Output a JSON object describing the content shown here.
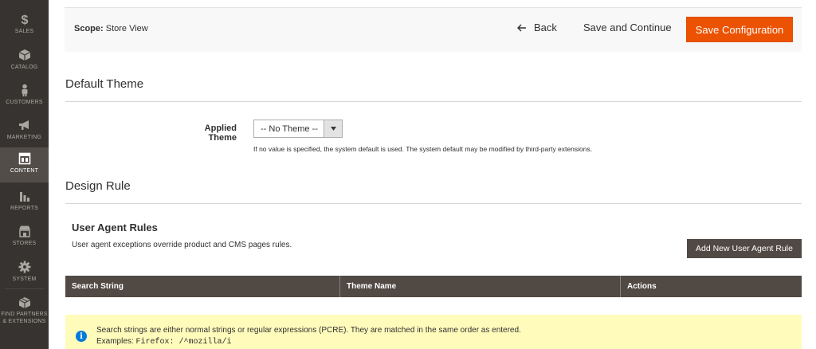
{
  "sidebar": {
    "items": [
      {
        "label": "SALES",
        "icon": "dollar-icon"
      },
      {
        "label": "CATALOG",
        "icon": "cube-icon"
      },
      {
        "label": "CUSTOMERS",
        "icon": "person-icon"
      },
      {
        "label": "MARKETING",
        "icon": "megaphone-icon"
      },
      {
        "label": "CONTENT",
        "icon": "layout-icon"
      },
      {
        "label": "REPORTS",
        "icon": "bar-chart-icon"
      },
      {
        "label": "STORES",
        "icon": "storefront-icon"
      },
      {
        "label": "SYSTEM",
        "icon": "gear-icon"
      },
      {
        "label_line1": "FIND PARTNERS",
        "label_line2": "& EXTENSIONS",
        "icon": "partner-cube-icon"
      }
    ],
    "active": "CONTENT"
  },
  "topbar": {
    "scope_label": "Scope:",
    "scope_value": "Store View",
    "back_label": "Back",
    "save_continue_label": "Save and Continue",
    "save_config_label": "Save Configuration"
  },
  "default_theme": {
    "title": "Default Theme",
    "applied_theme_label": "Applied Theme",
    "applied_theme_value": "-- No Theme --",
    "note": "If no value is specified, the system default is used. The system default may be modified by third-party extensions."
  },
  "design_rule": {
    "title": "Design Rule",
    "user_agent_title": "User Agent Rules",
    "user_agent_desc": "User agent exceptions override product and CMS pages rules.",
    "add_button_label": "Add New User Agent Rule",
    "columns": [
      "Search String",
      "Theme Name",
      "Actions"
    ],
    "notice_line1": "Search strings are either normal strings or regular expressions (PCRE). They are matched in the same order as entered.",
    "notice_examples_label": "Examples:",
    "notice_examples_code": "Firefox: /^mozilla/i"
  },
  "colors": {
    "accent": "#eb5202",
    "sidebar_bg": "#373330",
    "table_header_bg": "#514943",
    "notice_bg": "#fffbbb",
    "info_blue": "#007bdb"
  }
}
